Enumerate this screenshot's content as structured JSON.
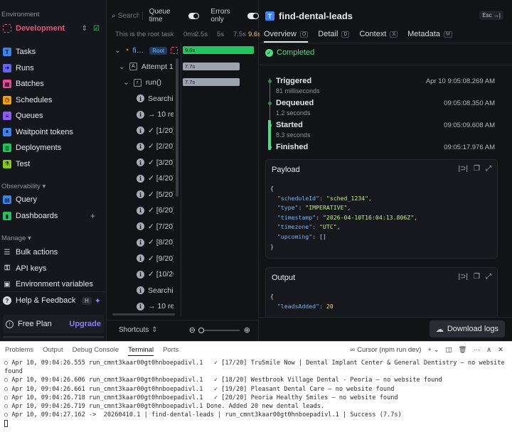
{
  "sidebar": {
    "environment_label": "Environment",
    "environment_name": "Development",
    "nav_primary": [
      {
        "label": "Tasks",
        "icon": "tasks-icon",
        "color": "#3b82f6"
      },
      {
        "label": "Runs",
        "icon": "runs-icon",
        "color": "#6366f1"
      },
      {
        "label": "Batches",
        "icon": "batches-icon",
        "color": "#ec4899"
      },
      {
        "label": "Schedules",
        "icon": "schedules-icon",
        "color": "#f59e0b"
      },
      {
        "label": "Queues",
        "icon": "queues-icon",
        "color": "#8b5cf6"
      },
      {
        "label": "Waitpoint tokens",
        "icon": "waitpoint-icon",
        "color": "#3b82f6"
      },
      {
        "label": "Deployments",
        "icon": "deployments-icon",
        "color": "#22c55e"
      },
      {
        "label": "Test",
        "icon": "test-icon",
        "color": "#84cc16"
      }
    ],
    "observability_label": "Observability",
    "nav_observability": [
      {
        "label": "Query",
        "icon": "query-icon",
        "color": "#3b82f6"
      },
      {
        "label": "Dashboards",
        "icon": "dashboards-icon",
        "color": "#22c55e"
      }
    ],
    "manage_label": "Manage",
    "nav_manage": [
      {
        "label": "Bulk actions",
        "icon": "bulk-actions-icon"
      },
      {
        "label": "API keys",
        "icon": "key-icon"
      },
      {
        "label": "Environment variables",
        "icon": "env-vars-icon"
      }
    ],
    "help_label": "Help & Feedback",
    "help_shortcut": "H",
    "free_plan_label": "Free Plan",
    "upgrade_label": "Upgrade"
  },
  "tree": {
    "search_placeholder": "Search",
    "queue_time_label": "Queue time",
    "errors_only_label": "Errors only",
    "root_label": "This is the root task",
    "scale_ticks": [
      "0ms",
      "2.5s",
      "5s",
      "7.5s",
      "9.6s"
    ],
    "root_row": {
      "name": "fi…",
      "badge": "Root",
      "duration": "9.6s"
    },
    "attempt_row": {
      "name": "Attempt 1",
      "duration": "7.7s"
    },
    "run_row": {
      "name": "run()",
      "duration": "7.7s"
    },
    "log_rows": [
      "Searchin",
      "→ 10 res",
      "✓ [1/20]",
      "✓ [2/20]",
      "✓ [3/20]",
      "✓ [4/20]",
      "✓ [5/20]",
      "✓ [6/20]",
      "✓ [7/20]",
      "✓ [8/20]",
      "✓ [9/20]",
      "✓ [10/20",
      "Searchin",
      "→ 10 res"
    ],
    "shortcuts_label": "Shortcuts"
  },
  "details": {
    "title": "find-dental-leads",
    "esc_label": "Esc",
    "tabs": [
      {
        "label": "Overview",
        "key": "O"
      },
      {
        "label": "Detail",
        "key": "D"
      },
      {
        "label": "Context",
        "key": "X"
      },
      {
        "label": "Metadata",
        "key": "M"
      }
    ],
    "status": "Completed",
    "timeline": [
      {
        "name": "Triggered",
        "time": "Apr 10 9:05:08.269 AM",
        "sub": "81 milliseconds"
      },
      {
        "name": "Dequeued",
        "time": "09:05:08.350 AM",
        "sub": "1.2 seconds"
      },
      {
        "name": "Started",
        "time": "09:05:09.608 AM",
        "sub": "8.3 seconds"
      },
      {
        "name": "Finished",
        "time": "09:05:17.976 AM",
        "sub": ""
      }
    ],
    "payload_title": "Payload",
    "payload": {
      "scheduleId": "sched_1234",
      "type": "IMPERATIVE",
      "timestamp": "2026-04-10T16:04:13.806Z",
      "timezone": "UTC",
      "upcoming": "[]"
    },
    "output_title": "Output",
    "output": {
      "leadsAdded": "20"
    },
    "download_label": "Download logs"
  },
  "terminal": {
    "tabs": [
      "Problems",
      "Output",
      "Debug Console",
      "Terminal",
      "Ports"
    ],
    "active_tab": "Terminal",
    "task_label": "Cursor (npm run dev)",
    "lines": [
      "○ Apr 10, 09:04:26.555 run_cmnt3kaar00gt0hnboepadivl.1   ✓ [17/20] TruSmile Now | Dental Implant Center & General Dentistry — no website found",
      "○ Apr 10, 09:04:26.606 run_cmnt3kaar00gt0hnboepadivl.1   ✓ [18/20] Westbrook Village Dental - Peoria — no website found",
      "○ Apr 10, 09:04:26.661 run_cmnt3kaar00gt0hnboepadivl.1   ✓ [19/20] Pleasant Dental Care — no website found",
      "○ Apr 10, 09:04:26.718 run_cmnt3kaar00gt0hnboepadivl.1   ✓ [20/20] Peoria Healthy Smiles — no website found",
      "○ Apr 10, 09:04:26.719 run_cmnt3kaar00gt0hnboepadivl.1 Done. Added 20 new dental leads.",
      "○ Apr 10, 09:04:27.162 ->  20260410.1 | find-dental-leads | run_cmnt3kaar00gt0hnboepadivl.1 | Success (7.7s)"
    ]
  }
}
